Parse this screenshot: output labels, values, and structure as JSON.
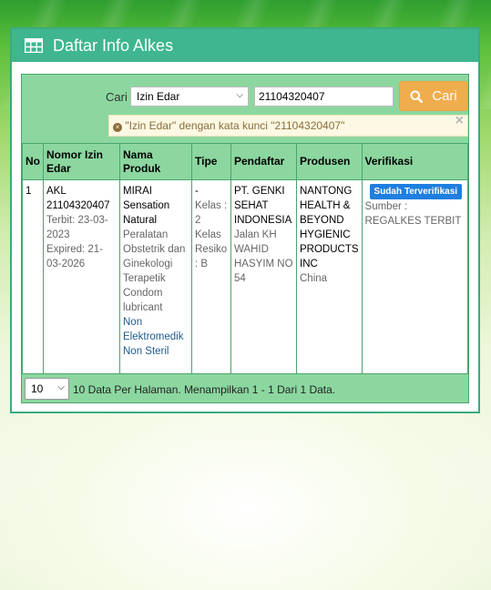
{
  "panel": {
    "title": "Daftar Info Alkes",
    "icon": "table-icon"
  },
  "search": {
    "label": "Cari",
    "field_selected": "Izin Edar",
    "keyword_value": "21104320407",
    "button_label": "Cari",
    "button_icon": "search-icon"
  },
  "alert": {
    "icon": "circle-x-icon",
    "text": "\"Izin Edar\" dengan kata kunci \"21104320407\"",
    "close": "×"
  },
  "table": {
    "headers": [
      "No",
      "Nomor Izin Edar",
      "Nama Produk",
      "Tipe",
      "Pendaftar",
      "Produsen",
      "Verifikasi"
    ],
    "rows": [
      {
        "no": "1",
        "izin_number": "AKL 21104320407",
        "terbit": "Terbit: 23-03-2023",
        "expired": "Expired: 21-03-2026",
        "product_name": "MIRAI Sensation Natural",
        "product_category": "Peralatan Obstetrik dan Ginekologi Terapetik Condom lubricant",
        "product_class": "Non Elektromedik Non Steril",
        "tipe_dash": "-",
        "tipe_detail": "Kelas : 2 Kelas Resiko : B",
        "pendaftar_name": "PT. GENKI SEHAT INDONESIA",
        "pendaftar_address": "Jalan KH WAHID HASYIM NO 54",
        "produsen_name": "NANTONG HEALTH & BEYOND HYGIENIC PRODUCTS INC",
        "produsen_country": "China",
        "verif_badge": "Sudah Terverifikasi",
        "verif_source": "Sumber : REGALKES TERBIT"
      }
    ]
  },
  "pagination": {
    "per_page": "10",
    "info": "10 Data Per Halaman. Menampilkan 1 - 1 Dari 1 Data."
  },
  "colors": {
    "header_green": "#3fb68f",
    "inner_green": "#8cd7a0",
    "button_orange": "#f0ad4e",
    "badge_blue": "#1e7fe0"
  }
}
